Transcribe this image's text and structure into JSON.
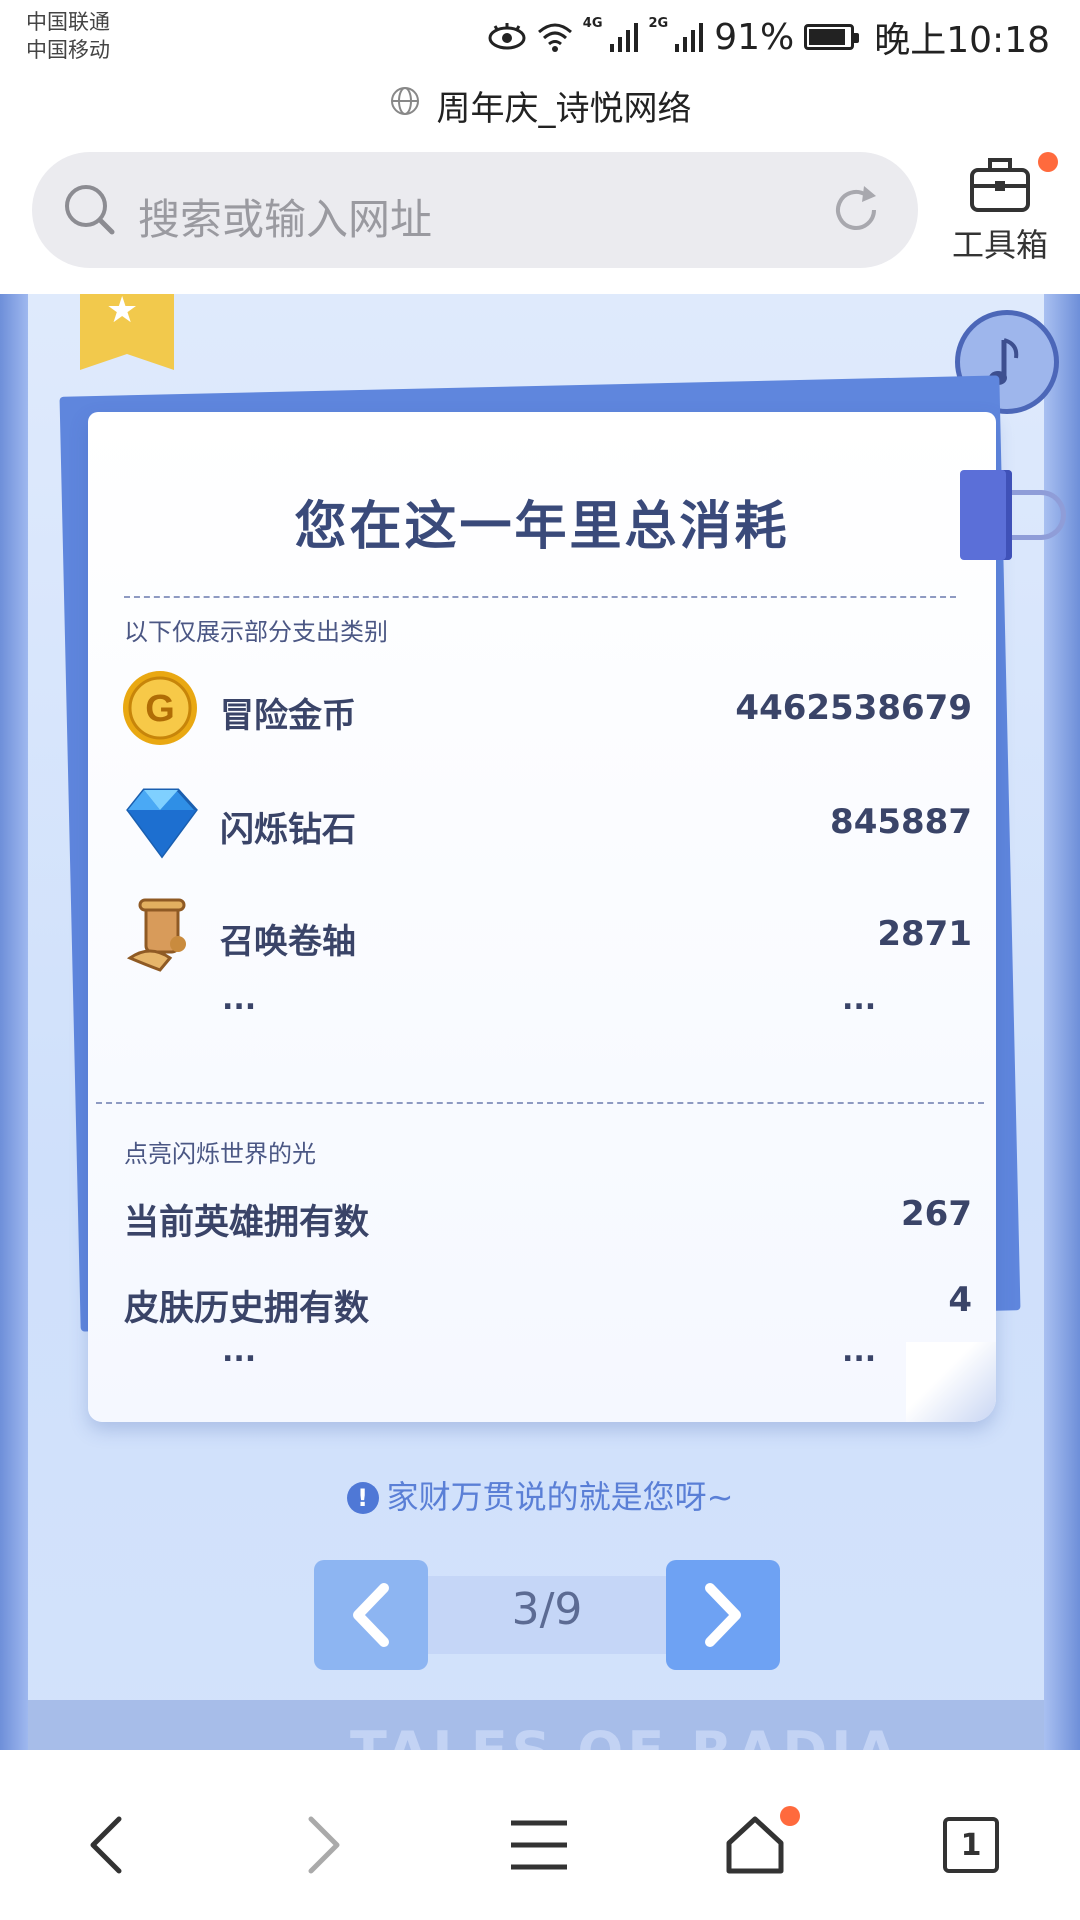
{
  "status_bar": {
    "carrier_1": "中国联通",
    "carrier_2": "中国移动",
    "net_4g": "4G",
    "net_2g": "2G",
    "battery_text": "91%",
    "battery_level": 0.91,
    "time": "晚上10:18"
  },
  "browser": {
    "page_title": "周年庆_诗悦网络",
    "search_placeholder": "搜索或输入网址",
    "toolbox_label": "工具箱",
    "tab_count": "1"
  },
  "card": {
    "title": "您在这一年里总消耗",
    "section1_note": "以下仅展示部分支出类别",
    "resources": [
      {
        "label": "冒险金币",
        "value": "4462538679",
        "icon": "gold-coin-icon"
      },
      {
        "label": "闪烁钻石",
        "value": "845887",
        "icon": "diamond-icon"
      },
      {
        "label": "召唤卷轴",
        "value": "2871",
        "icon": "scroll-icon"
      }
    ],
    "ellipsis": "...",
    "section2_note": "点亮闪烁世界的光",
    "stats": [
      {
        "label": "当前英雄拥有数",
        "value": "267"
      },
      {
        "label": "皮肤历史拥有数",
        "value": "4"
      }
    ]
  },
  "hint_text": "家财万贯说的就是您呀~",
  "hint_badge": "!",
  "pager": {
    "current_total": "3/9"
  },
  "banner_text": "TALES OF RADIA",
  "colors": {
    "accent": "#5a7fd6",
    "paper_blue": "#5f86dd",
    "badge_red": "#ff6a3d"
  }
}
